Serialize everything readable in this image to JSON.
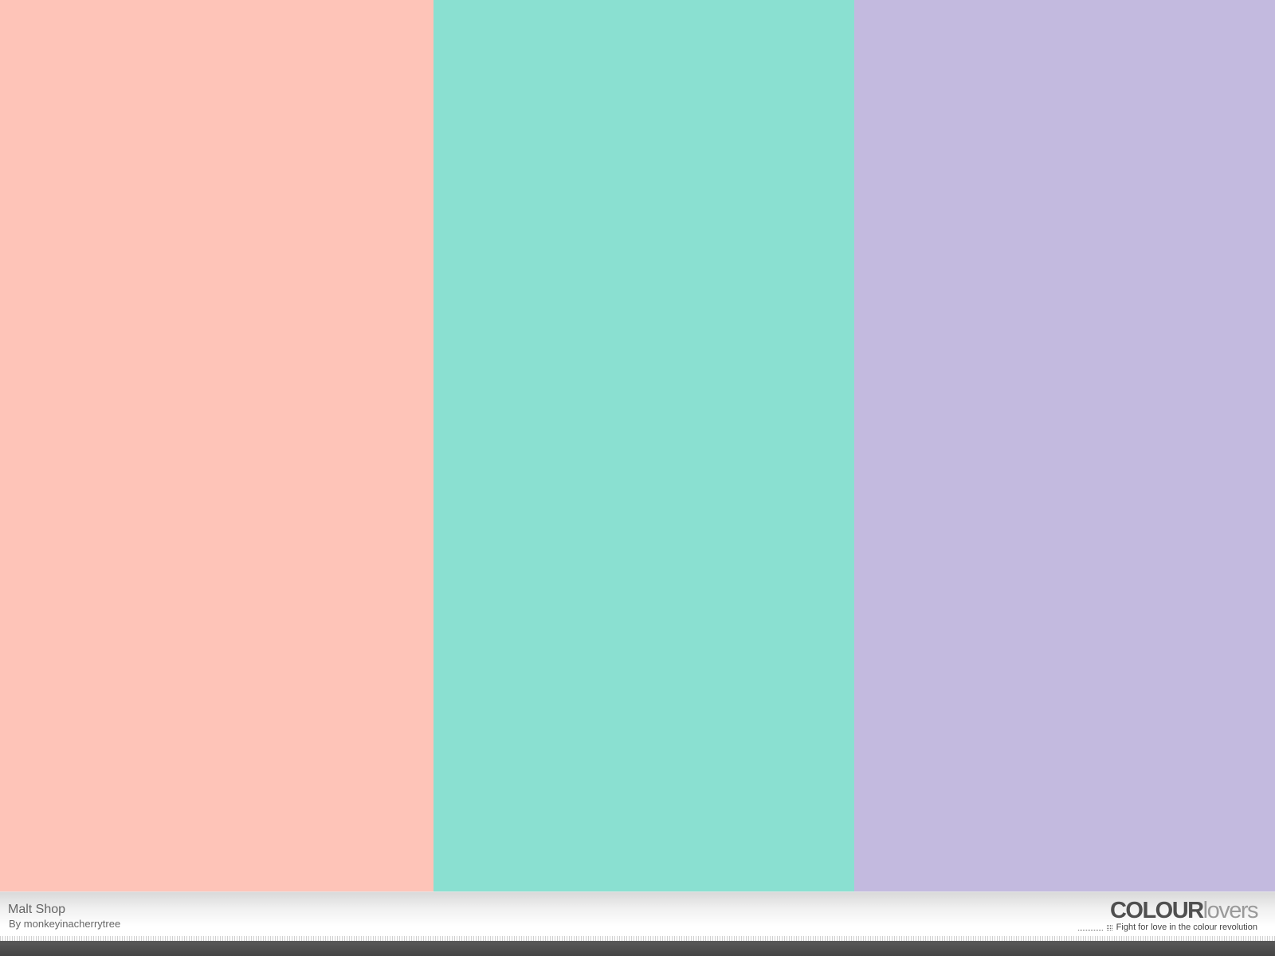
{
  "palette": {
    "title": "Malt Shop",
    "author": "By monkeyinacherrytree",
    "colors": [
      {
        "hex": "#FEC4B8",
        "share": 0.34
      },
      {
        "hex": "#8AE0D1",
        "share": 0.33
      },
      {
        "hex": "#C3BADF",
        "share": 0.33
      }
    ]
  },
  "brand": {
    "logo_bold": "COLOUR",
    "logo_light": "lovers",
    "tagline": "Fight for love in the colour revolution"
  }
}
